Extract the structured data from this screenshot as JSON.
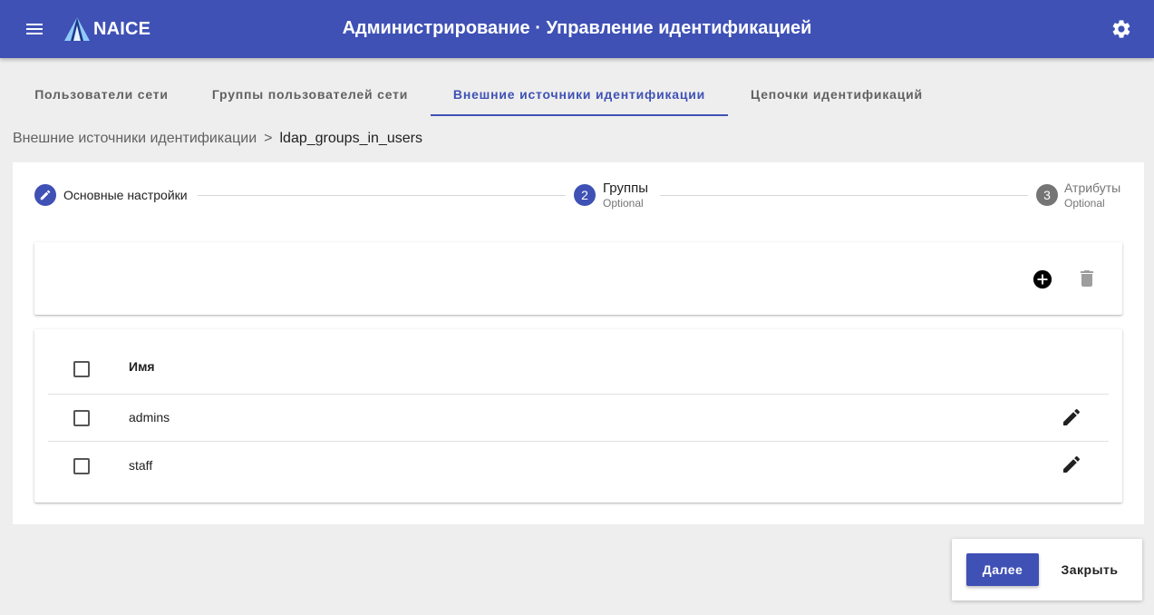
{
  "header": {
    "brand": "NAICE",
    "title": "Администрирование · Управление идентификацией",
    "background": "#3f51b5"
  },
  "tabs": [
    {
      "label": "Пользователи сети",
      "active": false
    },
    {
      "label": "Группы пользователей сети",
      "active": false
    },
    {
      "label": "Внешние источники идентификации",
      "active": true
    },
    {
      "label": "Цепочки идентификаций",
      "active": false
    }
  ],
  "breadcrumb": {
    "parent": "Внешние источники идентификации",
    "separator": ">",
    "current": "ldap_groups_in_users"
  },
  "stepper": {
    "steps": [
      {
        "number": "1",
        "label": "Основные настройки",
        "sub": "",
        "state": "edit",
        "icon": "pencil-icon",
        "color": "#3f51b5"
      },
      {
        "number": "2",
        "label": "Группы",
        "sub": "Optional",
        "state": "active",
        "color": "#3f51b5"
      },
      {
        "number": "3",
        "label": "Атрибуты",
        "sub": "Optional",
        "state": "inactive",
        "color": "#757575"
      }
    ]
  },
  "toolbar": {
    "add_icon": "add-circle-icon",
    "delete_icon": "trash-icon"
  },
  "table": {
    "columns": [
      "Имя"
    ],
    "rows": [
      {
        "name": "admins"
      },
      {
        "name": "staff"
      }
    ]
  },
  "actions": {
    "next": "Далее",
    "close": "Закрыть"
  }
}
